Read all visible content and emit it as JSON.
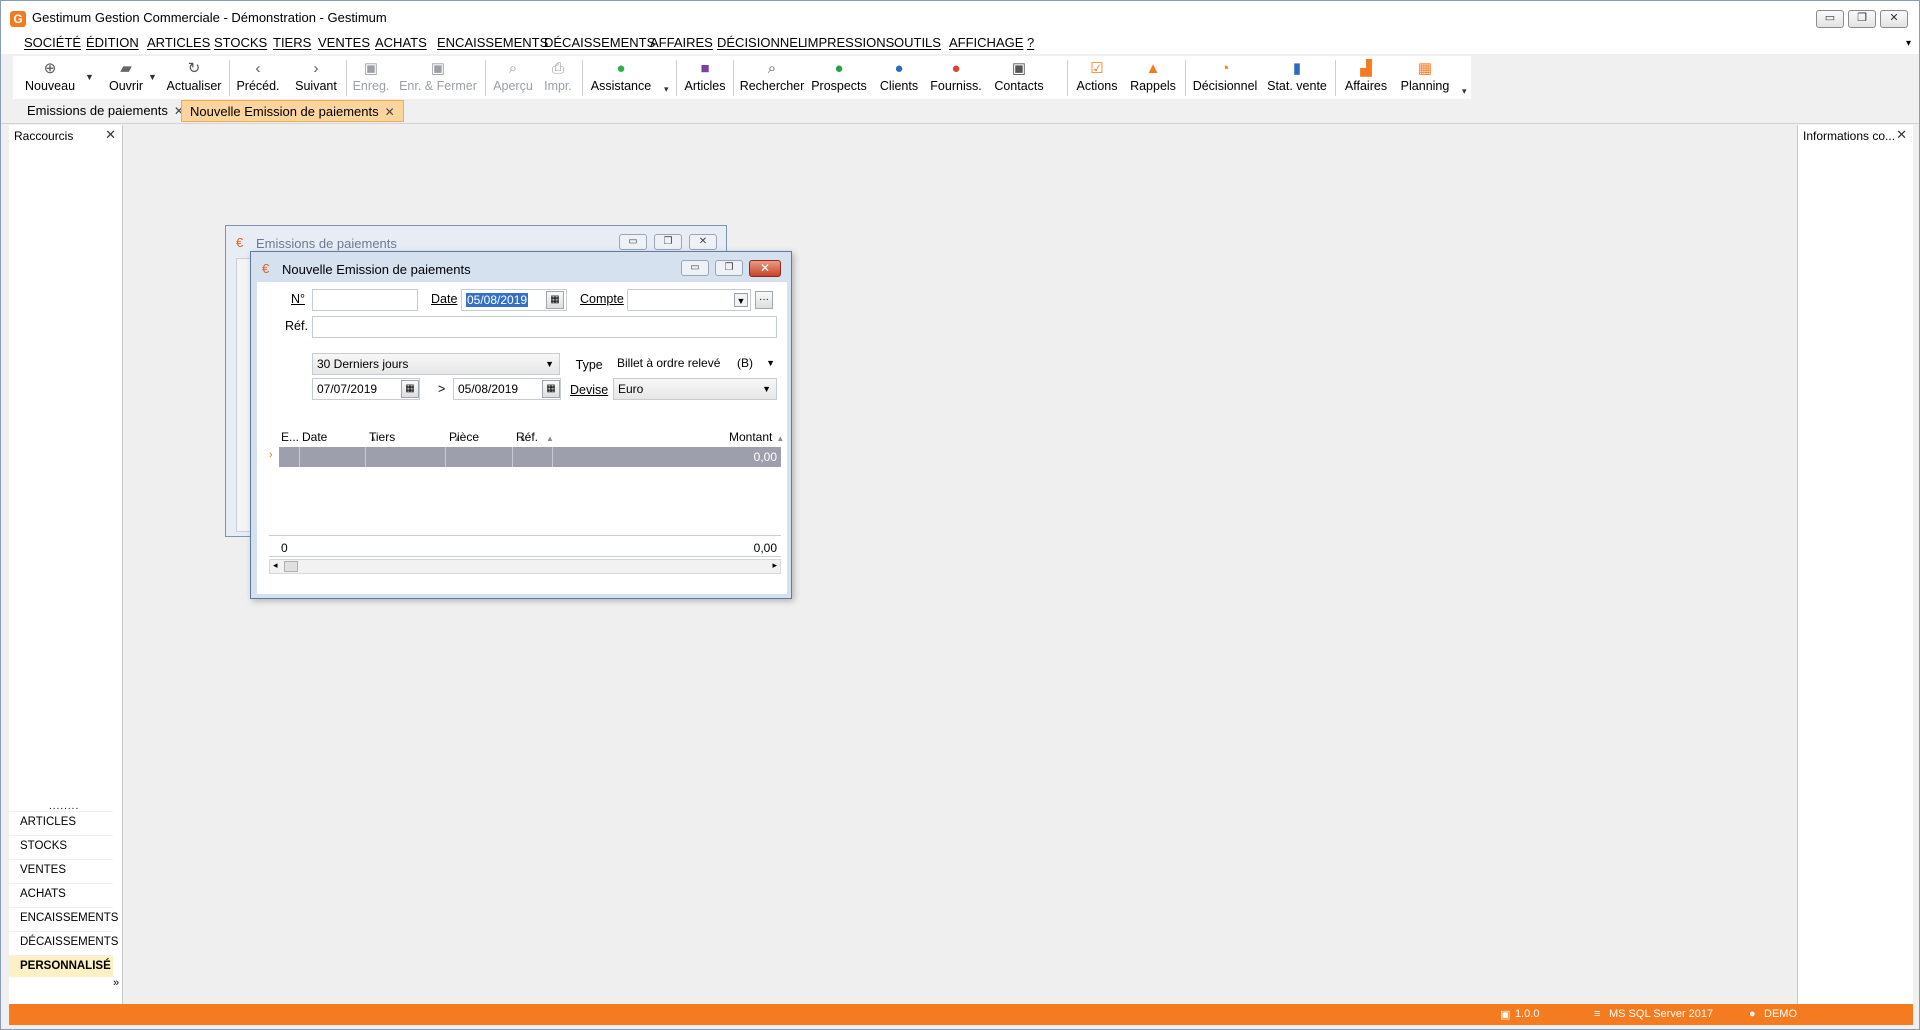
{
  "window": {
    "title": "Gestimum Gestion Commerciale - Démonstration - Gestimum",
    "logo_text": "G",
    "controls": [
      "▭",
      "❐",
      "✕"
    ]
  },
  "menu": [
    "SOCIÉTÉ",
    "ÉDITION",
    "ARTICLES",
    "STOCKS",
    "TIERS",
    "VENTES",
    "ACHATS",
    "ENCAISSEMENTS",
    "DÉCAISSEMENTS",
    "AFFAIRES",
    "DÉCISIONNEL",
    "IMPRESSIONS",
    "OUTILS",
    "AFFICHAGE",
    "?"
  ],
  "toolbar": {
    "nouveau": "Nouveau",
    "ouvrir": "Ouvrir",
    "actualiser": "Actualiser",
    "preced": "Précéd.",
    "suivant": "Suivant",
    "enreg": "Enreg.",
    "enr_fermer": "Enr. & Fermer",
    "apercu": "Aperçu",
    "impr": "Impr.",
    "assistance": "Assistance",
    "articles": "Articles",
    "rechercher": "Rechercher",
    "prospects": "Prospects",
    "clients": "Clients",
    "fourniss": "Fourniss.",
    "contacts": "Contacts",
    "actions": "Actions",
    "rappels": "Rappels",
    "decisionnel": "Décisionnel",
    "stat_vente": "Stat. vente",
    "affaires": "Affaires",
    "planning": "Planning"
  },
  "tabs": [
    {
      "label": "Emissions de paiements"
    },
    {
      "label": "Nouvelle Emission de paiements"
    }
  ],
  "left_panel": {
    "title": "Raccourcis",
    "grip": "........",
    "items": [
      "ARTICLES",
      "STOCKS",
      "VENTES",
      "ACHATS",
      "ENCAISSEMENTS",
      "DÉCAISSEMENTS",
      "PERSONNALISÉ"
    ]
  },
  "right_panel": {
    "title": "Informations co..."
  },
  "back_window": {
    "title": "Emissions de paiements"
  },
  "dialog": {
    "title": "Nouvelle Emission de paiements",
    "labels": {
      "num": "N°",
      "date": "Date",
      "compte": "Compte",
      "ref": "Réf.",
      "type": "Type",
      "devise": "Devise",
      "range_sep": ">"
    },
    "fields": {
      "num": "",
      "date": "05/08/2019",
      "compte": "",
      "ref": "",
      "period": "30 Derniers jours",
      "date_from": "07/07/2019",
      "date_to": "05/08/2019",
      "type": "Billet à ordre relevé",
      "type_code": "(B)",
      "devise": "Euro"
    },
    "grid": {
      "columns": [
        "E...",
        "Date",
        "Tiers",
        "Pièce",
        "Réf.",
        "Montant"
      ],
      "row_amount": "0,00",
      "footer_count": "0",
      "footer_total": "0,00"
    }
  },
  "status": {
    "version": "1.0.0",
    "server": "MS SQL Server 2017",
    "user": "DEMO"
  },
  "colors": {
    "accent": "#f47b20",
    "active_tab": "#fbd59d",
    "selection": "#3470c8",
    "grid_row": "#9d9fad"
  }
}
